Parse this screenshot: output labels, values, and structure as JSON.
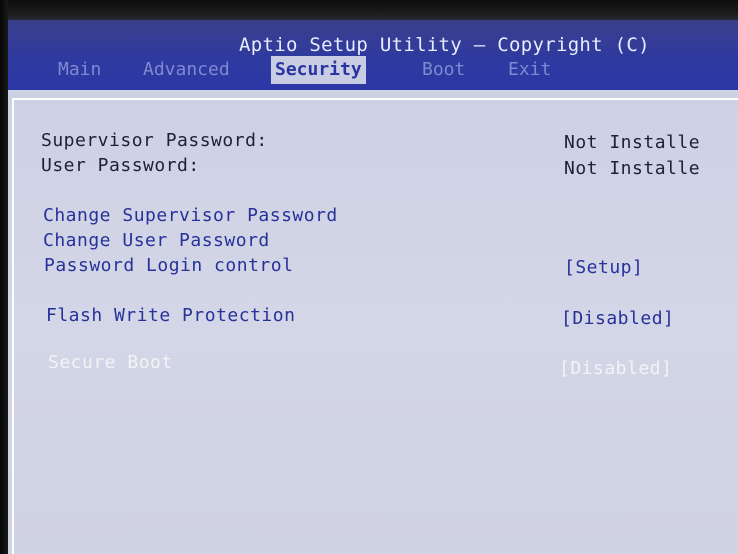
{
  "header": {
    "title": "Aptio Setup Utility – Copyright (C)"
  },
  "tabs": [
    {
      "label": "Main",
      "active": false
    },
    {
      "label": "Advanced",
      "active": false
    },
    {
      "label": "Security",
      "active": true
    },
    {
      "label": "Boot",
      "active": false
    },
    {
      "label": "Exit",
      "active": false
    }
  ],
  "security": {
    "supervisor_password": {
      "label": "Supervisor Password:",
      "value": "Not Installe"
    },
    "user_password": {
      "label": "User Password:",
      "value": "Not Installe"
    },
    "change_supervisor": {
      "label": "Change Supervisor Password"
    },
    "change_user": {
      "label": "Change User Password"
    },
    "password_login_control": {
      "label": "Password Login control",
      "value": "[Setup]"
    },
    "flash_write_protection": {
      "label": "Flash Write Protection",
      "value": "[Disabled]"
    },
    "secure_boot": {
      "label": "Secure Boot",
      "value": "[Disabled]"
    }
  },
  "colors": {
    "header_bg": "#2f3aa0",
    "panel_bg": "#cfd2e2",
    "selectable_text": "#27319a",
    "static_text": "#1e2033",
    "disabled_text": "#f3f3f6"
  }
}
